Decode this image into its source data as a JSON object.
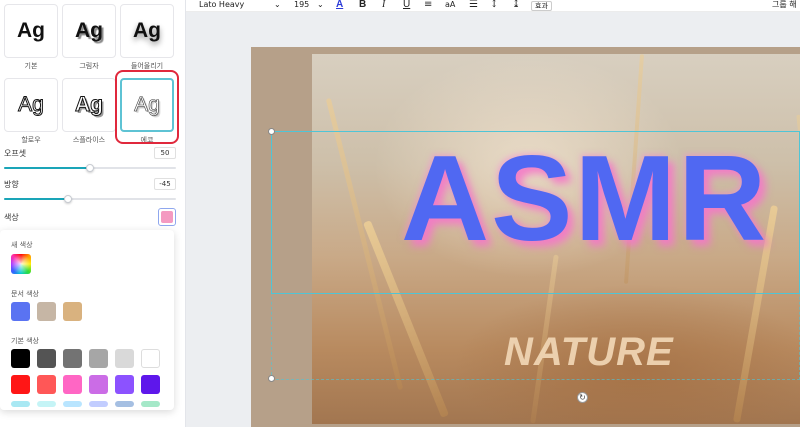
{
  "text_effects": {
    "styles": [
      {
        "preview": "Ag",
        "label": "기본"
      },
      {
        "preview": "Ag",
        "label": "그림자"
      },
      {
        "preview": "Ag",
        "label": "들어올리기"
      },
      {
        "preview": "Ag",
        "label": "할로우"
      },
      {
        "preview": "Ag",
        "label": "스플라이스"
      },
      {
        "preview": "Ag",
        "label": "에코"
      }
    ],
    "offset": {
      "label": "오프셋",
      "value": "50",
      "level": 0.5
    },
    "direction": {
      "label": "방향",
      "value": "-45",
      "level": 0.37
    },
    "color": {
      "label": "색상",
      "value": "#f49ac1"
    }
  },
  "color_picker": {
    "new_color_label": "새 색상",
    "document_colors_label": "문서 색상",
    "document_colors": [
      "#5a73f2",
      "#c6b6a5",
      "#d9b27f"
    ],
    "default_colors_label": "기본 색상",
    "default_colors_row1": [
      "#000000",
      "#545454",
      "#737373",
      "#a6a6a6",
      "#d9d9d9",
      "#ffffff"
    ],
    "default_colors_row2": [
      "#ff1616",
      "#ff5757",
      "#ff66c4",
      "#cb6ce6",
      "#8c52ff",
      "#5e17eb"
    ]
  },
  "toolbar": {
    "font_name": "Lato Heavy",
    "font_size": "195",
    "caret": "⌄",
    "text_color_glyph": "A",
    "bold": "B",
    "italic": "I",
    "underline": "U",
    "align_glyph": "≡",
    "case_glyph": "aA",
    "list_glyph": "☰",
    "spacing_glyph": "↕",
    "vertical_glyph": "↨",
    "effects_label": "효과",
    "right_label": "그룹 해"
  },
  "canvas": {
    "headline": "ASMR",
    "subtitle": "NATURE",
    "rotate_glyph": "↻"
  }
}
